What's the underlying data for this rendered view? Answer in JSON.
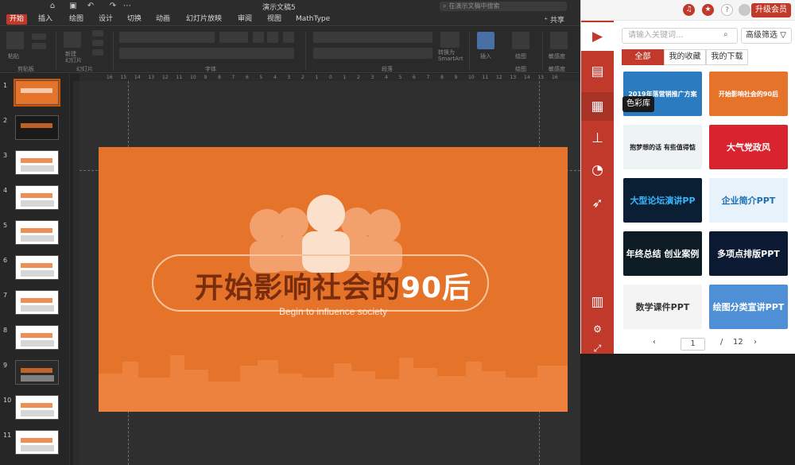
{
  "app": {
    "doc_title": "演示文稿5",
    "search_placeholder": "在演示文稿中搜索",
    "share_label": "共享",
    "tabs": [
      "开始",
      "插入",
      "绘图",
      "设计",
      "切换",
      "动画",
      "幻灯片放映",
      "审阅",
      "视图",
      "MathType"
    ],
    "ribbon_groups": [
      "剪贴板",
      "幻灯片",
      "字体",
      "段落",
      "绘图",
      "敏感度"
    ],
    "ribbon_labels": {
      "paste": "粘贴",
      "new_slide": "新建\n幻灯片",
      "convert": "转换为\nSmartArt",
      "insert": "插入",
      "draw": "绘图",
      "sensitivity": "敏感度"
    },
    "ruler_numbers": [
      "16",
      "15",
      "14",
      "13",
      "12",
      "11",
      "10",
      "9",
      "8",
      "7",
      "6",
      "5",
      "4",
      "3",
      "2",
      "1",
      "0",
      "1",
      "2",
      "3",
      "4",
      "5",
      "6",
      "7",
      "8",
      "9",
      "10",
      "11",
      "12",
      "13",
      "14",
      "15",
      "16"
    ],
    "thumb_numbers": [
      "1",
      "2",
      "3",
      "4",
      "5",
      "6",
      "7",
      "8",
      "9",
      "10",
      "11"
    ]
  },
  "slide": {
    "title_main": "开始影响社会的",
    "title_highlight": "90后",
    "subtitle": "Begin to influence society"
  },
  "panel": {
    "vip_label": "升级会员",
    "search_placeholder": "请输入关键词...",
    "advanced_filter": "高级筛选",
    "filters": [
      "全部",
      "我的收藏",
      "我的下载"
    ],
    "tooltip": "色彩库",
    "rail_icons": [
      "presentation-icon",
      "template-icon",
      "color-library-icon",
      "org-chart-icon",
      "chart-icon",
      "rocket-icon",
      "layout-icon",
      "settings-icon",
      "pin-icon"
    ],
    "cards": [
      {
        "text": "2019年落营销推广方案",
        "bg": "#2a7bbf",
        "fg": "#ffffff"
      },
      {
        "text": "开始影响社会的90后",
        "bg": "#e6732a",
        "fg": "#ffffff"
      },
      {
        "text": "抱梦想的话 有些值得惦",
        "bg": "#eef3f6",
        "fg": "#222222"
      },
      {
        "text": "大气党政风",
        "bg": "#d9232e",
        "fg": "#ffffff"
      },
      {
        "text": "大型论坛演讲PP",
        "bg": "#0b1f34",
        "fg": "#35b6ff"
      },
      {
        "text": "企业简介PPT",
        "bg": "#e8f2fa",
        "fg": "#1b6fb3"
      },
      {
        "text": "年终总结 创业案例",
        "bg": "#0d1b24",
        "fg": "#ffffff"
      },
      {
        "text": "多项点排版PPT",
        "bg": "#0c1933",
        "fg": "#ffffff"
      },
      {
        "text": "数学课件PPT",
        "bg": "#f4f4f4",
        "fg": "#333333"
      },
      {
        "text": "绘图分类宣讲PPT",
        "bg": "#4f8fd6",
        "fg": "#ffffff"
      }
    ],
    "pager": {
      "current": "1",
      "separator": "/",
      "total": "12",
      "prev": "‹",
      "next": "›"
    }
  }
}
